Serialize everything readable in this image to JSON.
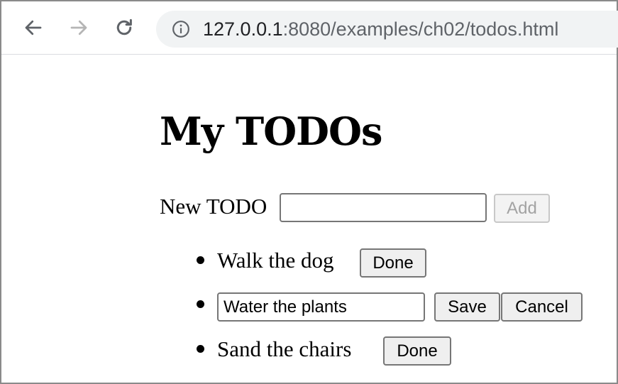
{
  "browser": {
    "back_icon": "arrow-left-icon",
    "forward_icon": "arrow-right-icon",
    "reload_icon": "reload-icon",
    "info_icon": "info-icon",
    "url_host": "127.0.0.1",
    "url_rest": ":8080/examples/ch02/todos.html"
  },
  "page": {
    "title": "My TODOs",
    "new_todo": {
      "label": "New TODO",
      "value": "",
      "add_label": "Add"
    },
    "todos": [
      {
        "text": "Walk the dog",
        "action": "Done"
      },
      {
        "edit_value": "Water the plants",
        "save_label": "Save",
        "cancel_label": "Cancel"
      },
      {
        "text": "Sand the chairs",
        "action": "Done"
      }
    ]
  }
}
